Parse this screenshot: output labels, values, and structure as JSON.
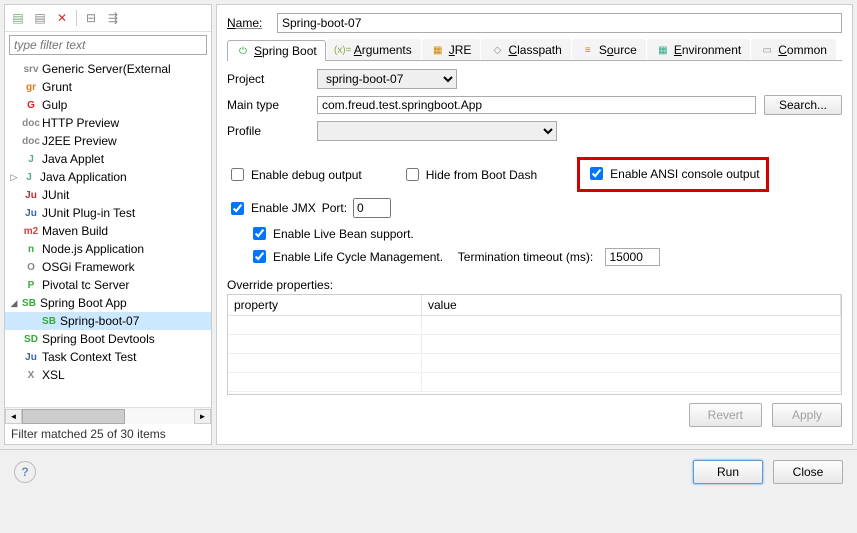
{
  "filter": {
    "placeholder": "type filter text"
  },
  "tree": [
    {
      "label": "Generic Server(External",
      "icon": "srv",
      "color": "#888"
    },
    {
      "label": "Grunt",
      "icon": "gr",
      "color": "#d97a1a"
    },
    {
      "label": "Gulp",
      "icon": "G",
      "color": "#d22"
    },
    {
      "label": "HTTP Preview",
      "icon": "doc",
      "color": "#888"
    },
    {
      "label": "J2EE Preview",
      "icon": "doc",
      "color": "#888"
    },
    {
      "label": "Java Applet",
      "icon": "J",
      "color": "#5a8"
    },
    {
      "label": "Java Application",
      "icon": "J",
      "color": "#5a8",
      "expand": "▷"
    },
    {
      "label": "JUnit",
      "icon": "Ju",
      "color": "#a33"
    },
    {
      "label": "JUnit Plug-in Test",
      "icon": "Ju",
      "color": "#36a"
    },
    {
      "label": "Maven Build",
      "icon": "m2",
      "color": "#c44"
    },
    {
      "label": "Node.js Application",
      "icon": "n",
      "color": "#3a3"
    },
    {
      "label": "OSGi Framework",
      "icon": "O",
      "color": "#888"
    },
    {
      "label": "Pivotal tc Server",
      "icon": "P",
      "color": "#4a4"
    },
    {
      "label": "Spring Boot App",
      "icon": "SB",
      "color": "#3a3",
      "expand": "◢"
    },
    {
      "label": "Spring-boot-07",
      "icon": "SB",
      "color": "#3a3",
      "child": true,
      "selected": true
    },
    {
      "label": "Spring Boot Devtools",
      "icon": "SD",
      "color": "#3a3"
    },
    {
      "label": "Task Context Test",
      "icon": "Ju",
      "color": "#36a"
    },
    {
      "label": "XSL",
      "icon": "X",
      "color": "#888"
    }
  ],
  "status": "Filter matched 25 of 30 items",
  "name": {
    "label": "Name:",
    "value": "Spring-boot-07"
  },
  "tabs": [
    {
      "label": "Spring Boot",
      "icon": "⏻",
      "color": "#3a3",
      "active": true
    },
    {
      "label": "Arguments",
      "icon": "(x)=",
      "color": "#8a5"
    },
    {
      "label": "JRE",
      "icon": "▦",
      "color": "#c80"
    },
    {
      "label": "Classpath",
      "icon": "◇",
      "color": "#888"
    },
    {
      "label": "Source",
      "icon": "≡",
      "color": "#c80"
    },
    {
      "label": "Environment",
      "icon": "▦",
      "color": "#3a8"
    },
    {
      "label": "Common",
      "icon": "▭",
      "color": "#888"
    }
  ],
  "form": {
    "project_label": "Project",
    "project_value": "spring-boot-07",
    "maintype_label": "Main type",
    "maintype_value": "com.freud.test.springboot.App",
    "search_label": "Search...",
    "profile_label": "Profile",
    "profile_value": ""
  },
  "checks": {
    "enable_debug": "Enable debug output",
    "hide_dash": "Hide from Boot Dash",
    "enable_ansi": "Enable ANSI console output",
    "enable_jmx": "Enable JMX",
    "port_label": "Port:",
    "port_value": "0",
    "live_bean": "Enable Live Bean support.",
    "lifecycle": "Enable Life Cycle Management.",
    "term_label": "Termination timeout (ms):",
    "term_value": "15000"
  },
  "override": {
    "label": "Override properties:",
    "col_prop": "property",
    "col_val": "value"
  },
  "buttons": {
    "revert": "Revert",
    "apply": "Apply",
    "run": "Run",
    "close": "Close"
  },
  "mnemonics": {
    "name_u": "N",
    "springboot_u": "S",
    "arguments_u": "A",
    "jre_u": "J",
    "classpath_u": "C",
    "source_u": "o",
    "environment_u": "E",
    "common_u": "C"
  }
}
